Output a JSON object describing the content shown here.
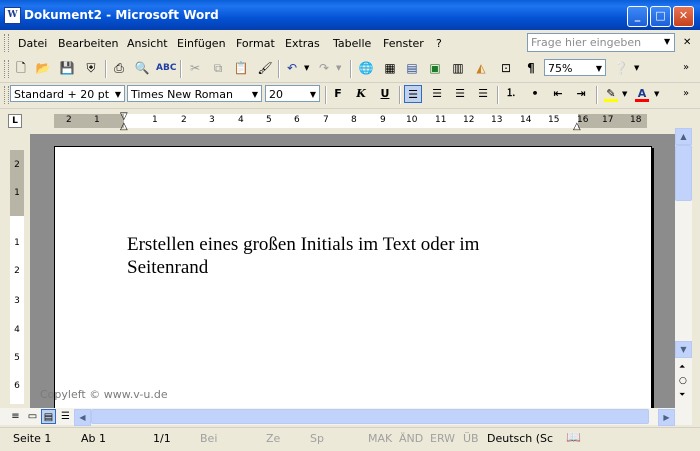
{
  "window": {
    "title": "Dokument2 - Microsoft Word",
    "app_icon": "W"
  },
  "title_buttons": {
    "minimize": "_",
    "maximize": "□",
    "close": "✕"
  },
  "menu": {
    "items": [
      "Datei",
      "Bearbeiten",
      "Ansicht",
      "Einfügen",
      "Format",
      "Extras",
      "Tabelle",
      "Fenster",
      "?"
    ],
    "help_placeholder": "Frage hier eingeben"
  },
  "standard_toolbar": {
    "icons": [
      "new-document-icon",
      "open-folder-icon",
      "save-icon",
      "permission-icon",
      "print-icon",
      "print-preview-icon",
      "spelling-icon",
      "cut-icon",
      "copy-icon",
      "paste-icon",
      "format-painter-icon",
      "undo-icon",
      "redo-icon",
      "hyperlink-icon",
      "tables-borders-icon",
      "insert-table-icon",
      "insert-excel-icon",
      "columns-icon",
      "drawing-icon",
      "document-map-icon",
      "show-formatting-icon",
      "help-icon"
    ],
    "zoom": "75%"
  },
  "formatting_toolbar": {
    "style": "Standard + 20 pt",
    "font": "Times New Roman",
    "size": "20",
    "bold": "F",
    "italic": "K",
    "underline": "U",
    "highlight_color": "#ffff00",
    "font_color": "#ff0000"
  },
  "ruler": {
    "numbers": [
      "2",
      "1",
      "1",
      "2",
      "3",
      "4",
      "5",
      "6",
      "7",
      "8",
      "9",
      "10",
      "11",
      "12",
      "13",
      "14",
      "15",
      "16",
      "17",
      "18"
    ],
    "vertical_numbers": [
      "2",
      "1",
      "1",
      "2",
      "3",
      "4",
      "5",
      "6"
    ],
    "tab_selector": "L"
  },
  "document": {
    "text": "Erstellen eines großen Initials im Text oder im Seitenrand"
  },
  "watermark": "Copyleft © www.v-u.de",
  "status_bar": {
    "page": "Seite  1",
    "section": "Ab  1",
    "pages": "1/1",
    "at": "Bei",
    "line": "Ze",
    "column": "Sp",
    "rec": "MAK",
    "trk": "ÄND",
    "ext": "ERW",
    "ovr": "ÜB",
    "language": "Deutsch (Sc"
  }
}
